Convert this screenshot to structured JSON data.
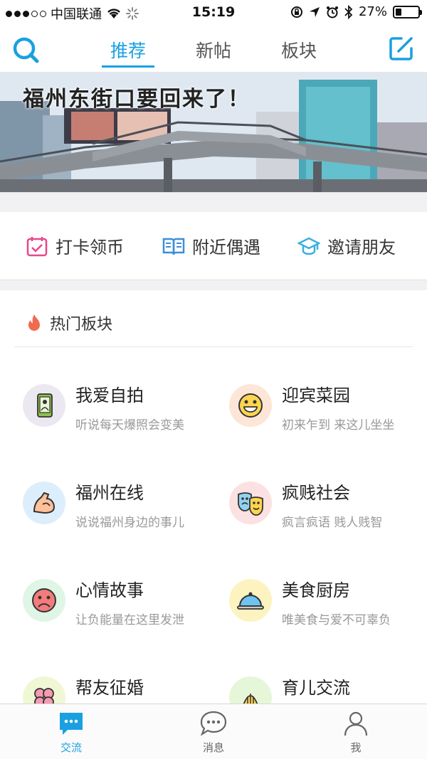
{
  "status_bar": {
    "carrier": "中国联通",
    "time": "15:19",
    "battery": "27%",
    "battery_level": 0.27
  },
  "nav": {
    "tabs": [
      {
        "label": "推荐",
        "active": true
      },
      {
        "label": "新帖",
        "active": false
      },
      {
        "label": "板块",
        "active": false
      }
    ],
    "search_icon": "search-icon",
    "compose_icon": "compose-icon",
    "accent_color": "#1aa0e0"
  },
  "banner": {
    "title": "福州东街口要回来了！"
  },
  "quick_actions": [
    {
      "label": "打卡领币",
      "icon": "calendar-checkin-icon",
      "color": "#e8468c"
    },
    {
      "label": "附近偶遇",
      "icon": "book-icon",
      "color": "#3a8fd8"
    },
    {
      "label": "邀请朋友",
      "icon": "graduation-cap-icon",
      "color": "#3ab0e0"
    }
  ],
  "hot_boards": {
    "title": "热门板块",
    "icon": "flame-icon",
    "items": [
      {
        "name": "我爱自拍",
        "desc": "听说每天爆照会变美",
        "icon": "selfie-phone-icon",
        "bg": "#ece8f2"
      },
      {
        "name": "迎宾菜园",
        "desc": "初来乍到 来这儿坐坐",
        "icon": "smiley-icon",
        "bg": "#fde6d7"
      },
      {
        "name": "福州在线",
        "desc": "说说福州身边的事儿",
        "icon": "arm-muscle-icon",
        "bg": "#dceefc"
      },
      {
        "name": "疯贱社会",
        "desc": "疯言疯语 贱人贱智",
        "icon": "theater-masks-icon",
        "bg": "#fbe1e1"
      },
      {
        "name": "心情故事",
        "desc": "让负能量在这里发泄",
        "icon": "sad-face-icon",
        "bg": "#dff5e5"
      },
      {
        "name": "美食厨房",
        "desc": "唯美食与爱不可辜负",
        "icon": "food-cloche-icon",
        "bg": "#fdf3c0"
      },
      {
        "name": "帮友征婚",
        "desc": "",
        "icon": "clover-icon",
        "bg": "#f0f7d4"
      },
      {
        "name": "育儿交流",
        "desc": "",
        "icon": "baby-icon",
        "bg": "#e5f6d9"
      }
    ]
  },
  "tab_bar": {
    "items": [
      {
        "label": "交流",
        "icon": "chat-bubble-icon",
        "active": true
      },
      {
        "label": "消息",
        "icon": "message-icon",
        "active": false
      },
      {
        "label": "我",
        "icon": "user-icon",
        "active": false
      }
    ]
  }
}
